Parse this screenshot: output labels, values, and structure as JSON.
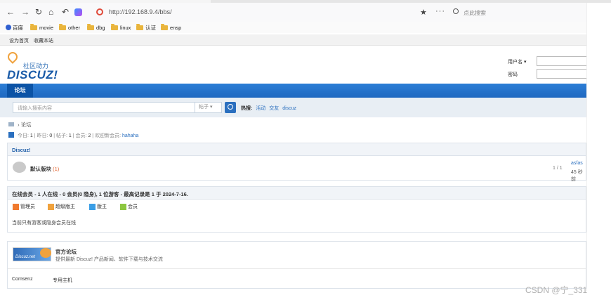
{
  "browser": {
    "url": "http://192.168.9.4/bbs/",
    "search_placeholder": "点此搜索",
    "bookmarks": [
      "百度",
      "movie",
      "other",
      "dbg",
      "linux",
      "认证",
      "ensp"
    ]
  },
  "quickbar": {
    "set_home": "设为首页",
    "bookmark": "收藏本站"
  },
  "header": {
    "logo_cn": "社区动力",
    "logo_en": "DISCUZ!",
    "username_label": "用户名",
    "password_label": "密码"
  },
  "nav": {
    "tab": "论坛"
  },
  "search": {
    "placeholder": "请输入搜索内容",
    "type": "帖子",
    "hot_label": "热搜:",
    "hot_items": [
      "活动",
      "交友",
      "discuz"
    ]
  },
  "breadcrumb": {
    "current": "论坛"
  },
  "stats": {
    "today_label": "今日:",
    "today": "1",
    "yesterday_label": "昨日:",
    "yesterday": "0",
    "posts_label": "帖子:",
    "posts": "1",
    "members_label": "会员:",
    "members": "2",
    "newest_label": "欢迎新会员:",
    "newest": "hahaha"
  },
  "forum_group": {
    "title": "Discuz!",
    "forum_name": "默认版块",
    "today_count": "(1)",
    "count": "1 / 1",
    "last_user": "asfas",
    "last_time": "45 秒前"
  },
  "online": {
    "title": "在线会员 - 1 人在线 - 0 会员(0 隐身), 1 位游客 - 最高记录是 1 于 2024-7-16.",
    "legend": [
      {
        "label": "管理员",
        "color": "#f07a2e"
      },
      {
        "label": "超级版主",
        "color": "#f0a23d"
      },
      {
        "label": "版主",
        "color": "#3a9ee6"
      },
      {
        "label": "会员",
        "color": "#8cc63f"
      }
    ],
    "note": "当前只有游客或隐身会员在线"
  },
  "links": {
    "logo_text": "Discuz.net",
    "title": "官方论坛",
    "desc": "提供最新 Discuz! 产品新闻、软件下载与技术交流",
    "bottom": [
      "Comsenz",
      "专用主机"
    ]
  },
  "watermark": "CSDN @宁_331"
}
